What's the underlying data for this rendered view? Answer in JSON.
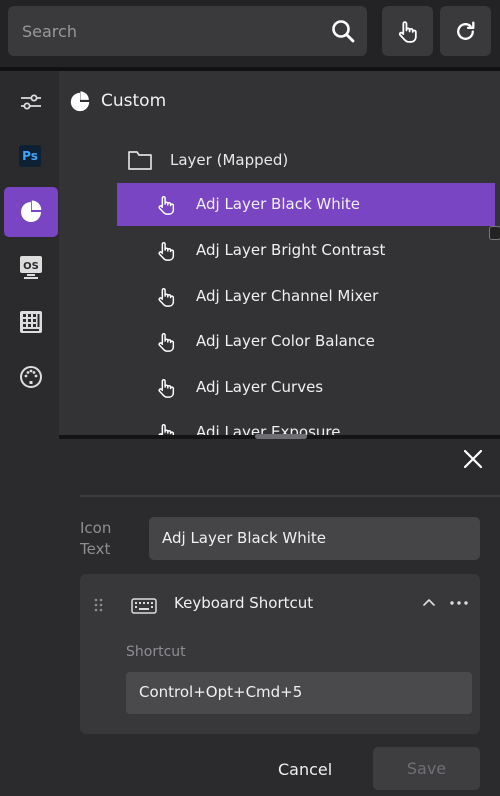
{
  "search": {
    "placeholder": "Search"
  },
  "topbar": {
    "touch_icon": "hand-pointer-icon",
    "refresh_icon": "refresh-icon"
  },
  "rail": {
    "items": [
      {
        "icon": "sliders-icon",
        "active": false
      },
      {
        "icon": "photoshop-icon",
        "label": "Ps",
        "active": false
      },
      {
        "icon": "custom-pie-icon",
        "active": true
      },
      {
        "icon": "os-icon",
        "label": "OS",
        "active": false
      },
      {
        "icon": "keypad-icon",
        "active": false
      },
      {
        "icon": "midi-icon",
        "active": false
      }
    ]
  },
  "main": {
    "header": "Custom",
    "folder": "Layer (Mapped)",
    "items": [
      {
        "label": "Adj Layer Black White",
        "selected": true
      },
      {
        "label": "Adj Layer Bright Contrast",
        "selected": false
      },
      {
        "label": "Adj Layer Channel Mixer",
        "selected": false
      },
      {
        "label": "Adj Layer Color Balance",
        "selected": false
      },
      {
        "label": "Adj Layer Curves",
        "selected": false
      },
      {
        "label": "Adj Layer Exposure",
        "selected": false
      }
    ]
  },
  "panel": {
    "icon_text_label_1": "Icon",
    "icon_text_label_2": "Text",
    "icon_text_value": "Adj Layer Black White",
    "action": {
      "title": "Keyboard Shortcut",
      "shortcut_label": "Shortcut",
      "shortcut_value": "Control+Opt+Cmd+5"
    },
    "cancel_label": "Cancel",
    "save_label": "Save"
  },
  "colors": {
    "accent": "#7a45c2",
    "background": "#232325",
    "panel": "#2b2b2d"
  }
}
